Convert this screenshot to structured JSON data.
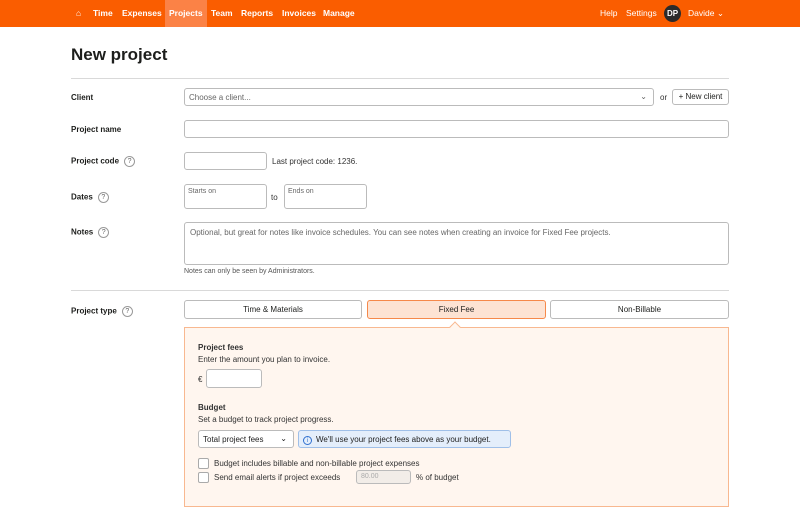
{
  "nav": {
    "items": [
      "Time",
      "Expenses",
      "Projects",
      "Team",
      "Reports",
      "Invoices",
      "Manage"
    ],
    "help": "Help",
    "settings": "Settings",
    "avatar": "DP",
    "user": "Davide"
  },
  "title": "New project",
  "client": {
    "label": "Client",
    "placeholder": "Choose a client...",
    "or": "or",
    "new_client": "+ New client"
  },
  "project_name": {
    "label": "Project name",
    "value": ""
  },
  "project_code": {
    "label": "Project code",
    "hint": "Last project code: 1236."
  },
  "dates": {
    "label": "Dates",
    "starts": "Starts on",
    "to": "to",
    "ends": "Ends on"
  },
  "notes": {
    "label": "Notes",
    "placeholder": "Optional, but great for notes like invoice schedules. You can see notes when creating an invoice for Fixed Fee projects.",
    "hint": "Notes can only be seen by Administrators."
  },
  "project_type": {
    "label": "Project type",
    "options": [
      "Time & Materials",
      "Fixed Fee",
      "Non-Billable"
    ],
    "selected": "Fixed Fee"
  },
  "fees": {
    "title": "Project fees",
    "desc": "Enter the amount you plan to invoice.",
    "currency": "€"
  },
  "budget": {
    "title": "Budget",
    "desc": "Set a budget to track project progress.",
    "select": "Total project fees",
    "info": "We'll use your project fees above as your budget.",
    "check1": "Budget includes billable and non-billable project expenses",
    "check2": "Send email alerts if project exceeds",
    "alert_value": "80.00",
    "alert_suffix": "% of budget"
  }
}
